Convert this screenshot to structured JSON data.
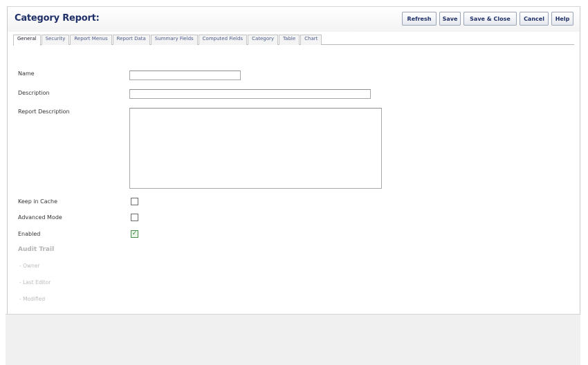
{
  "title": "Category Report:",
  "toolbar": {
    "refresh_label": "Refresh",
    "save_label": "Save",
    "save_close_label": "Save & Close",
    "cancel_label": "Cancel",
    "help_label": "Help"
  },
  "tabs": [
    {
      "label": "General",
      "active": true
    },
    {
      "label": "Security"
    },
    {
      "label": "Report Menus"
    },
    {
      "label": "Report Data"
    },
    {
      "label": "Summary Fields"
    },
    {
      "label": "Computed Fields"
    },
    {
      "label": "Category"
    },
    {
      "label": "Table"
    },
    {
      "label": "Chart"
    }
  ],
  "form": {
    "name_label": "Name",
    "name_value": "",
    "description_label": "Description",
    "description_value": "",
    "report_description_label": "Report Description",
    "report_description_value": "",
    "keep_in_cache_label": "Keep in Cache",
    "keep_in_cache_checked": false,
    "advanced_mode_label": "Advanced Mode",
    "advanced_mode_checked": false,
    "enabled_label": "Enabled",
    "enabled_checked": true
  },
  "audit": {
    "title": "Audit Trail",
    "owner_label": "- Owner",
    "last_editor_label": "- Last Editor",
    "modified_label": "- Modified"
  },
  "colors": {
    "title_text": "#1f2f67",
    "accent_blue": "#1a3db8",
    "enabled_check": "#2f8a2f"
  }
}
